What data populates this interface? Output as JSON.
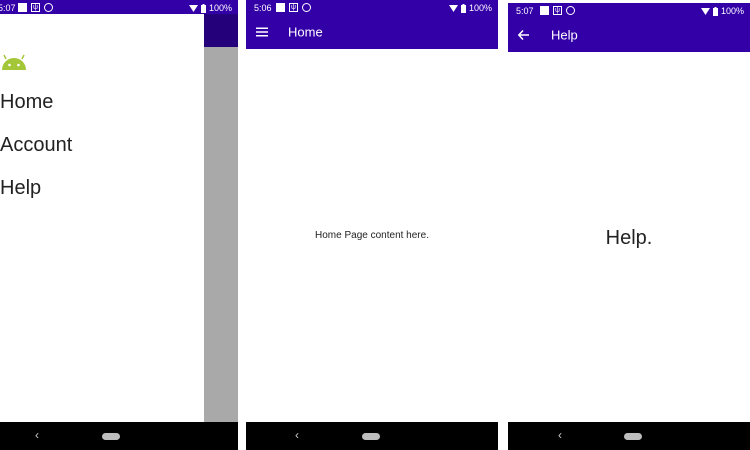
{
  "colors": {
    "primary": "#3300a8",
    "drawer_scrim": "#a9a9a9",
    "nav_bar": "#000000"
  },
  "phone1": {
    "status": {
      "time": "5:07",
      "battery": "100%"
    },
    "drawer": {
      "logo_icon": "android-icon",
      "items": [
        {
          "label": "Home"
        },
        {
          "label": "Account"
        },
        {
          "label": "Help"
        }
      ]
    }
  },
  "phone2": {
    "status": {
      "time": "5:06",
      "battery": "100%"
    },
    "appbar": {
      "nav_icon": "menu-icon",
      "title": "Home"
    },
    "content": {
      "text": "Home Page content here."
    }
  },
  "phone3": {
    "status": {
      "time": "5:07",
      "battery": "100%"
    },
    "appbar": {
      "nav_icon": "back-arrow-icon",
      "title": "Help"
    },
    "content": {
      "text": "Help."
    }
  }
}
